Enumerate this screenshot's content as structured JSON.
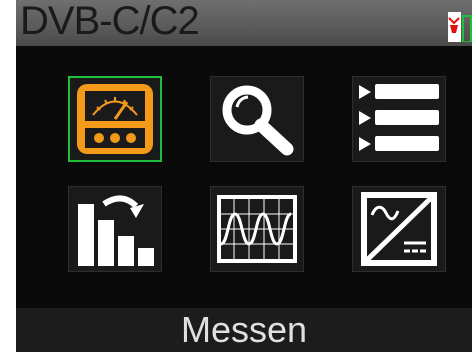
{
  "header": {
    "title": "DVB-C/C2",
    "icons": [
      "antenna-icon",
      "battery-icon"
    ]
  },
  "menu": {
    "selected_index": 0,
    "items": [
      {
        "icon": "meter-gauge-icon"
      },
      {
        "icon": "magnifier-icon"
      },
      {
        "icon": "list-icon"
      },
      {
        "icon": "bar-chart-icon"
      },
      {
        "icon": "waveform-icon"
      },
      {
        "icon": "signal-converter-icon"
      }
    ]
  },
  "footer": {
    "label": "Messen"
  },
  "colors": {
    "accent": "#f39a1b",
    "selection": "#1fbf3a",
    "icon_fg": "#ffffff",
    "header_bg": "#5f5f5f",
    "panel_bg": "#0a0a0a"
  }
}
